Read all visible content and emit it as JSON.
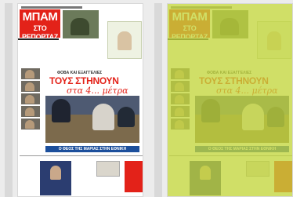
{
  "masthead": {
    "line1": "ΜΠΑΜ",
    "line2": "ΣΤΟ ΡΕΠΟΡΤΑΖ"
  },
  "kicker": "ΦΟΒΑ ΚΑΙ ΕΞΑΓΓΕΛΙΕΣ",
  "headline": "ΤΟΥΣ ΣΤΗΝΟΥΝ",
  "subheadline": "στα 4... μέτρα",
  "blue_bar_text": "Ο ΘΕΟΣ ΤΗΣ ΜΑΡΙΑΣ ΣΤΗΝ ΕΘΝΙΚΗ",
  "colors": {
    "brand_red": "#e32219",
    "bar_blue": "#1c4f9c",
    "tint": "#c3d63c"
  },
  "pages": [
    {
      "name": "original"
    },
    {
      "name": "tinted"
    }
  ]
}
